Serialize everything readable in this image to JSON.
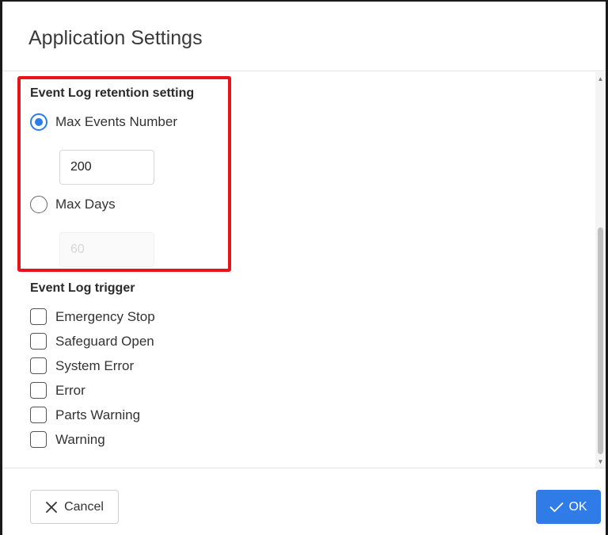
{
  "dialog": {
    "title": "Application Settings"
  },
  "retention": {
    "title": "Event Log retention setting",
    "options": [
      {
        "label": "Max Events Number",
        "checked": true,
        "value": "200"
      },
      {
        "label": "Max Days",
        "checked": false,
        "value": "60"
      }
    ]
  },
  "trigger": {
    "title": "Event Log trigger",
    "items": [
      {
        "label": "Emergency Stop",
        "checked": false
      },
      {
        "label": "Safeguard Open",
        "checked": false
      },
      {
        "label": "System Error",
        "checked": false
      },
      {
        "label": "Error",
        "checked": false
      },
      {
        "label": "Parts Warning",
        "checked": false
      },
      {
        "label": "Warning",
        "checked": false
      }
    ]
  },
  "footer": {
    "cancel_label": "Cancel",
    "ok_label": "OK"
  },
  "colors": {
    "accent": "#2f7be8",
    "highlight": "#e8131b"
  },
  "icons": {
    "cancel": "close-icon",
    "ok": "check-icon"
  }
}
